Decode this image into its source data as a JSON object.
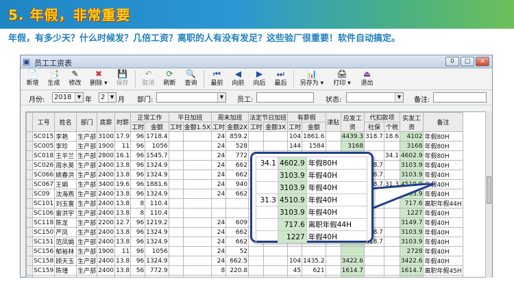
{
  "banner": {
    "title": "5. 年假，非常重要",
    "subtitle": "年假，有多少天？什么时候发？几倍工资？离职的人有没有发足？这些验厂很重要！软件自动搞定。"
  },
  "window": {
    "title": "员工工资表",
    "controls": [
      "0",
      "□",
      "×"
    ]
  },
  "toolbar": {
    "buttons": [
      {
        "icon": "📄",
        "label": "新增"
      },
      {
        "icon": "📑",
        "label": "生成"
      },
      {
        "icon": "✎",
        "label": "修改"
      },
      {
        "icon": "✖",
        "label": "删除 ▾"
      },
      {
        "icon": "💾",
        "label": "保存"
      },
      {
        "icon": "↶",
        "label": "取消"
      },
      {
        "icon": "⟳",
        "label": "刷新"
      },
      {
        "icon": "🔍",
        "label": "查询"
      },
      {
        "icon": "⏮",
        "label": "最前"
      },
      {
        "icon": "◀",
        "label": "向前"
      },
      {
        "icon": "▶",
        "label": "向后"
      },
      {
        "icon": "⏭",
        "label": "最后"
      },
      {
        "icon": "📊",
        "label": "另存为 ▾"
      },
      {
        "icon": "🖨",
        "label": "打印 ▾"
      },
      {
        "icon": "⏏",
        "label": "退出"
      }
    ]
  },
  "filter": {
    "month_label": "月份:",
    "year": "2018",
    "year_unit": "年",
    "month": "2",
    "month_unit": "月",
    "dept_label": "部门:",
    "emp_label": "员工:",
    "status_label": "状态:",
    "note_label": "备注:"
  },
  "grid": {
    "headers_top": [
      "工号",
      "姓名",
      "部门",
      "底薪",
      "时薪",
      "正常工作",
      "平日加班",
      "周末加班",
      "法定节日加班",
      "有薪假",
      "津贴",
      "应发工资",
      "代扣款项",
      "实发工资",
      "备注"
    ],
    "headers_sub": [
      "工时",
      "金额",
      "工时",
      "金额1.5X",
      "工时",
      "金额2X",
      "工时",
      "金额3X",
      "工时",
      "金额",
      "社保",
      "个税"
    ],
    "rows": [
      [
        "SC015",
        "李艳",
        "生产部",
        "3100",
        "17.9",
        "96",
        "1718.4",
        "",
        "",
        "24",
        "859.2",
        "",
        "",
        "104",
        "1861.6",
        "",
        "4439.3",
        "318.7",
        "18.6",
        "4102",
        "年假80H"
      ],
      [
        "SC005",
        "李珍",
        "生产部",
        "1900",
        "11",
        "96",
        "1056",
        "",
        "",
        "24",
        "528",
        "",
        "",
        "144",
        "1584",
        "",
        "3168",
        "",
        "",
        "3168",
        "年假80H"
      ],
      [
        "SC018",
        "王平兰",
        "生产部",
        "2800",
        "16.1",
        "96",
        "1545.7",
        "",
        "",
        "24",
        "772",
        "",
        "",
        "",
        "",
        "",
        "",
        "",
        "34.1",
        "4602.9",
        "年假80H"
      ],
      [
        "SC026",
        "周水英",
        "生产部",
        "2400",
        "13.8",
        "96",
        "1324.9",
        "",
        "",
        "24",
        "662",
        "",
        "",
        "",
        "",
        "",
        "",
        "318.7",
        "",
        "3103.9",
        "年假40H"
      ],
      [
        "SC066",
        "姚春洪",
        "生产部",
        "2400",
        "13.8",
        "96",
        "1324.9",
        "",
        "",
        "24",
        "662",
        "",
        "",
        "",
        "",
        "",
        "",
        "318.7",
        "",
        "3103.9",
        "年假40H"
      ],
      [
        "SC067",
        "王娟",
        "生产部",
        "3400",
        "19.6",
        "96",
        "1881.6",
        "",
        "",
        "24",
        "940",
        "",
        "",
        "",
        "",
        "",
        "",
        "318.7",
        "31.3",
        "4510.9",
        "年假40H"
      ],
      [
        "SC09",
        "沈海燕",
        "生产部",
        "2400",
        "13.8",
        "96",
        "1324.9",
        "",
        "",
        "24",
        "662",
        "",
        "",
        "",
        "",
        "",
        "",
        "318.7",
        "",
        "3103.9",
        "年假40H"
      ],
      [
        "SC101",
        "刘玉富",
        "生产部",
        "2400",
        "13.8",
        "8",
        "110.4",
        "",
        "",
        "",
        "",
        "",
        "",
        "",
        "",
        "",
        "",
        "",
        "",
        "717.6",
        "离职年假44H"
      ],
      [
        "SC106",
        "雷洪宇",
        "生产部",
        "2400",
        "13.8",
        "8",
        "110.4",
        "",
        "",
        "",
        "",
        "",
        "",
        "",
        "",
        "",
        "",
        "",
        "",
        "1227",
        "年假40H"
      ],
      [
        "SC118",
        "陈龙",
        "生产部",
        "2200",
        "12.7",
        "96",
        "1219.2",
        "",
        "",
        "24",
        "609",
        "",
        "",
        "",
        "",
        "",
        "",
        "",
        "",
        "3149.7",
        "年假40H"
      ],
      [
        "SC150",
        "严凤",
        "生产部",
        "2400",
        "13.8",
        "96",
        "1324.9",
        "",
        "",
        "24",
        "662",
        "",
        "",
        "",
        "",
        "",
        "",
        "318.7",
        "",
        "3103.9",
        "年假40H"
      ],
      [
        "SC151",
        "范凤娟",
        "生产部",
        "2400",
        "13.8",
        "96",
        "1324.9",
        "",
        "",
        "24",
        "662",
        "",
        "",
        "",
        "",
        "",
        "",
        "318.7",
        "",
        "3103.9",
        "年假40H"
      ],
      [
        "SC156",
        "郁裕林",
        "生产部",
        "1900",
        "11",
        "96",
        "1056",
        "",
        "",
        "24",
        "52",
        "",
        "",
        "",
        "",
        "",
        "",
        "",
        "",
        "2728",
        "年假40H"
      ],
      [
        "SC158",
        "顾天玉",
        "生产部",
        "2400",
        "13.8",
        "96",
        "1324.9",
        "",
        "",
        "24",
        "662.5",
        "",
        "",
        "104",
        "1435.2",
        "",
        "3422.6",
        "",
        "",
        "3422.6",
        "年假40H"
      ],
      [
        "SC159",
        "陈瑾",
        "生产部",
        "2400",
        "13.8",
        "56",
        "772.9",
        "",
        "",
        "8",
        "220.8",
        "",
        "",
        "45",
        "621",
        "",
        "1614.7",
        "",
        "",
        "1614.7",
        "离职年假45H"
      ],
      [
        "SC162",
        "陈春香",
        "生产部",
        "2400",
        "13.8",
        "96",
        "1324.9",
        "",
        "",
        "24",
        "662.5",
        "",
        "",
        "104",
        "1435.2",
        "",
        "3422.6",
        "318.7",
        "",
        "3103.9",
        "年假40H"
      ]
    ]
  },
  "callout": {
    "rows": [
      [
        "34.1",
        "4602.9",
        "年假80H"
      ],
      [
        "",
        "3103.9",
        "年假40H"
      ],
      [
        "",
        "3103.9",
        "年假40H"
      ],
      [
        "31.3",
        "4510.9",
        "年假40H"
      ],
      [
        "",
        "3103.9",
        "年假40H"
      ],
      [
        "",
        "717.6",
        "离职年假44H"
      ],
      [
        "",
        "1227",
        "年假40H"
      ]
    ]
  },
  "colors": {
    "banner_title": "#ffd21a",
    "subtitle": "#1f7fbe",
    "highlight_cell": "#cde8c9",
    "callout_border": "#1f3f86"
  }
}
